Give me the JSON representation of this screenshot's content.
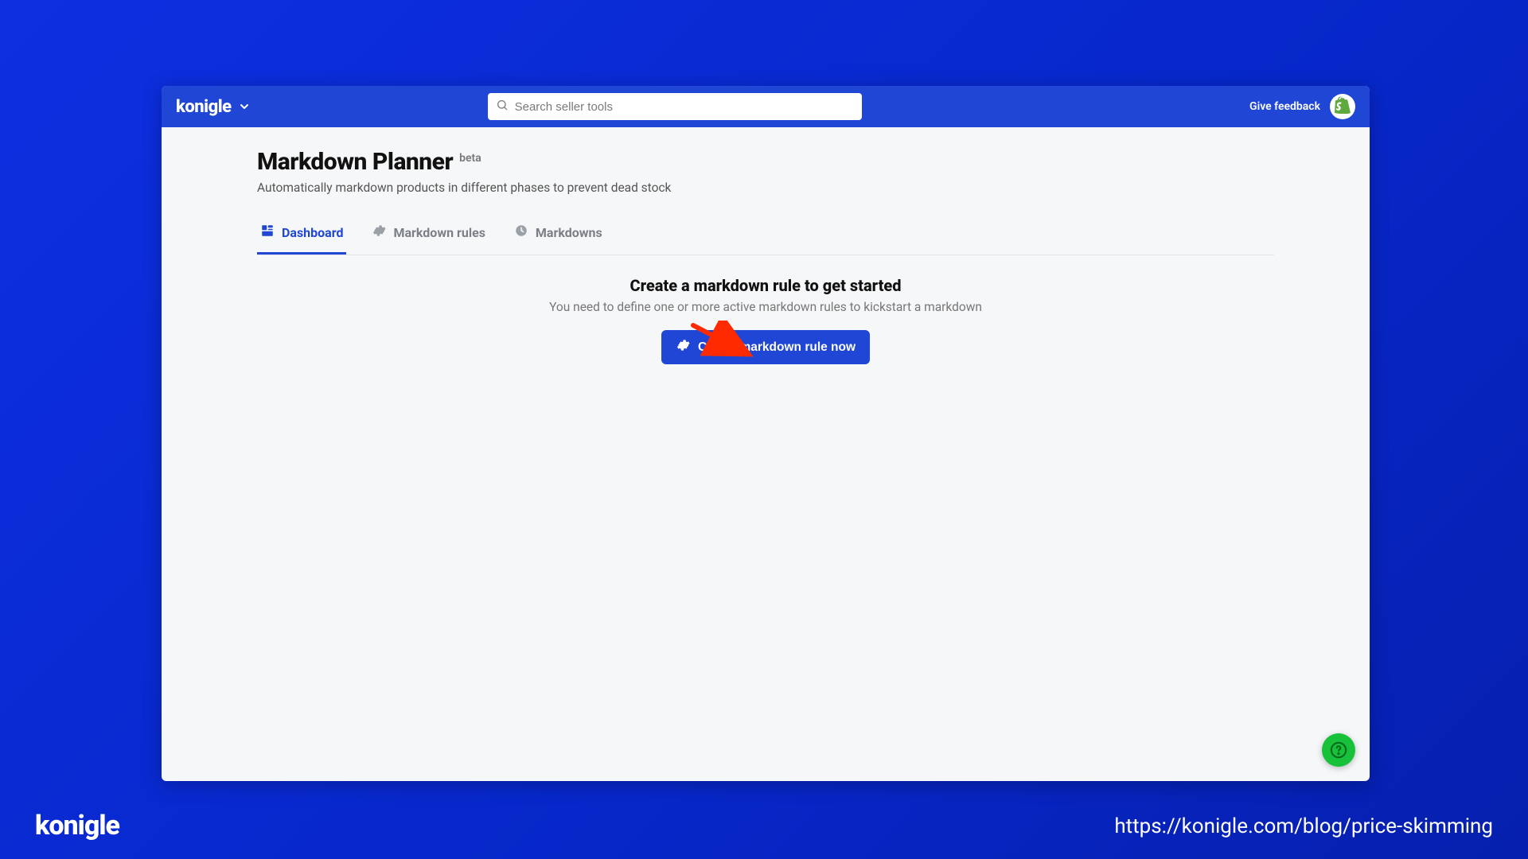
{
  "brand": {
    "name": "konigle"
  },
  "search": {
    "placeholder": "Search seller tools"
  },
  "header_right": {
    "feedback": "Give feedback"
  },
  "page": {
    "title": "Markdown Planner",
    "badge": "beta",
    "subtitle": "Automatically markdown products in different phases to prevent dead stock"
  },
  "tabs": [
    {
      "label": "Dashboard",
      "icon": "dashboard-icon",
      "active": true
    },
    {
      "label": "Markdown rules",
      "icon": "gear-icon",
      "active": false
    },
    {
      "label": "Markdowns",
      "icon": "clock-icon",
      "active": false
    }
  ],
  "empty_state": {
    "title": "Create a markdown rule to get started",
    "subtitle": "You need to define one or more active markdown rules to kickstart a markdown",
    "cta": "Create markdown rule now"
  },
  "footer": {
    "logo": "konigle",
    "url": "https://konigle.com/blog/price-skimming"
  },
  "colors": {
    "accent": "#1f46d4",
    "help": "#17c23a"
  }
}
